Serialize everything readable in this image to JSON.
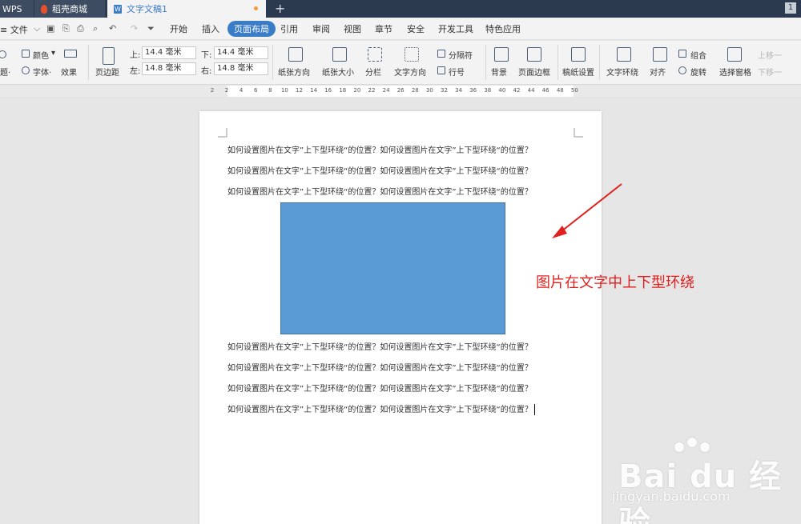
{
  "titlebar": {
    "tabs": {
      "wps": "WPS",
      "store": "稻壳商城",
      "doc": "文字文稿1"
    },
    "new_tab": "+",
    "window_count": "1"
  },
  "menubar": {
    "file": "≡ 文件",
    "items": [
      "开始",
      "插入",
      "页面布局",
      "引用",
      "审阅",
      "视图",
      "章节",
      "安全",
      "开发工具",
      "特色应用"
    ],
    "active_item": "页面布局"
  },
  "ribbon": {
    "theme_label": "题·",
    "color_label": "颜色",
    "font_label": "字体·",
    "effect_label": "效果",
    "margins_label": "页边距",
    "top_label": "上:",
    "top_value": "14.4 毫米",
    "bottom_label": "下:",
    "bottom_value": "14.4 毫米",
    "left_label": "左:",
    "left_value": "14.8 毫米",
    "right_label": "右:",
    "right_value": "14.8 毫米",
    "orientation_label": "纸张方向",
    "size_label": "纸张大小",
    "columns_label": "分栏",
    "text_direction_label": "文字方向",
    "separator_label": "分隔符",
    "line_number_label": "行号",
    "background_label": "背景",
    "page_border_label": "页面边框",
    "manuscript_label": "稿纸设置",
    "text_wrap_label": "文字环绕",
    "align_label": "对齐",
    "group_label": "组合",
    "rotate_label": "旋转",
    "selection_pane_label": "选择窗格",
    "bring_forward_label": "上移一",
    "send_backward_label": "下移一"
  },
  "ruler": {
    "ticks": [
      "2",
      "2",
      "4",
      "6",
      "8",
      "10",
      "12",
      "14",
      "16",
      "18",
      "20",
      "22",
      "24",
      "26",
      "28",
      "30",
      "32",
      "34",
      "36",
      "38",
      "40",
      "42",
      "44",
      "46",
      "48",
      "50"
    ]
  },
  "document": {
    "lines_above": [
      "如何设置图片在文字”上下型环绕“的位置？如何设置图片在文字”上下型环绕“的位置？",
      "如何设置图片在文字”上下型环绕“的位置？如何设置图片在文字”上下型环绕“的位置？",
      "如何设置图片在文字”上下型环绕“的位置？如何设置图片在文字”上下型环绕“的位置？"
    ],
    "lines_below": [
      "如何设置图片在文字”上下型环绕“的位置？如何设置图片在文字”上下型环绕“的位置？",
      "如何设置图片在文字”上下型环绕“的位置？如何设置图片在文字”上下型环绕“的位置？",
      "如何设置图片在文字”上下型环绕“的位置？如何设置图片在文字”上下型环绕“的位置？",
      "如何设置图片在文字”上下型环绕“的位置？如何设置图片在文字”上下型环绕“的位置？"
    ],
    "picture_color": "#5b9bd5"
  },
  "annotation": {
    "text": "图片在文字中上下型环绕",
    "color": "#e0201f"
  },
  "watermark": {
    "main": "Bai du 经验",
    "sub": "jingyan.baidu.com"
  },
  "colors": {
    "accent": "#3b7cc9",
    "titlebar": "#2b3a4f"
  }
}
